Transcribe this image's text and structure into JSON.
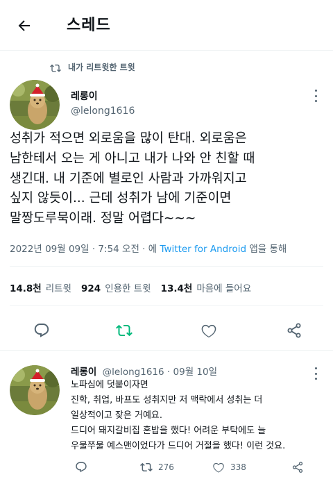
{
  "header": {
    "title": "스레드"
  },
  "retweet_context": {
    "label": "내가 리트윗한 트윗"
  },
  "tweet": {
    "author_name": "레롱이",
    "author_handle": "@lelong1616",
    "body_lines": [
      "성취가 적으면 외로움을 많이 탄대. 외로움은",
      "남한테서 오는 게 아니고 내가 나와 안 친할 때",
      "생긴대. 내 기준에 별로인 사람과 가까워지고",
      "싶지 않듯이... 근데 성취가 남에 기준이면",
      "말짱도루묵이래. 정말 어렵다~~~"
    ],
    "meta": {
      "datetime": "2022년 09월 09일 · 7:54 오전",
      "via_prefix": " · 에 ",
      "client": "Twitter for Android",
      "via_suffix": " 앱을 통해"
    },
    "stats": {
      "retweets_count": "14.8천",
      "retweets_label": "리트윗",
      "quotes_count": "924",
      "quotes_label": "인용한 트윗",
      "likes_count": "13.4천",
      "likes_label": "마음에 들어요"
    },
    "actions": [
      "reply-icon",
      "retweet-icon",
      "like-icon",
      "share-icon"
    ],
    "colors": {
      "retweet_active": "#00ba7c",
      "link": "#1d9bf0",
      "muted": "#536471"
    }
  },
  "reply": {
    "author_name": "레롱이",
    "author_handle": "@lelong1616",
    "separator": "·",
    "date": "09월 10일",
    "body_lines": [
      "노파심에 덧붙이자면",
      "진학, 취업, 바프도 성취지만 저 맥락에서 성취는 더",
      "일상적이고 잦은 거예요.",
      "드디어 돼지갈비집 혼밥을 했다! 어려운 부탁에도 늘",
      "우물쭈물 예스맨이었다가 드디어 거절을 했다! 이런 것요."
    ],
    "actions": {
      "retweets": "276",
      "likes": "338"
    }
  }
}
